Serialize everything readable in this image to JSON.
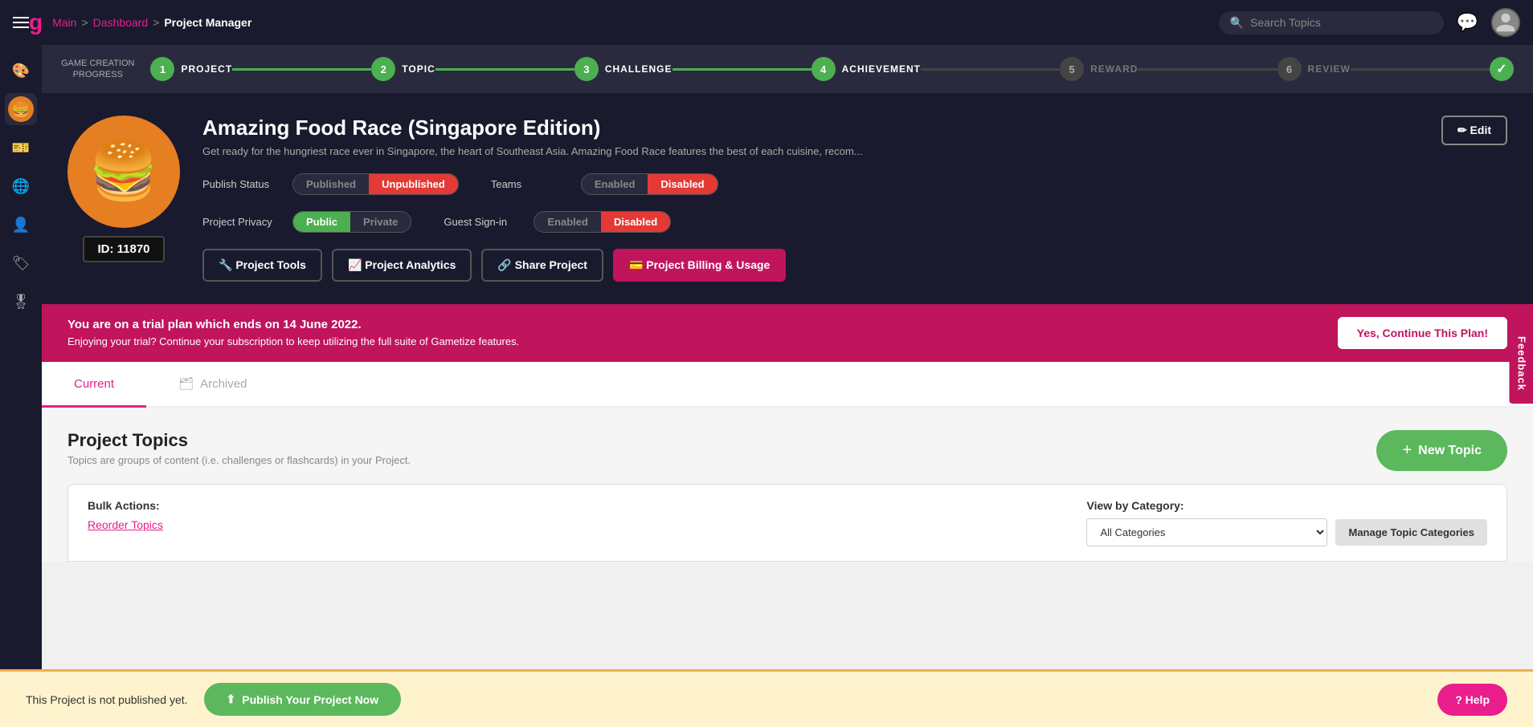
{
  "nav": {
    "brand": "g",
    "breadcrumb": {
      "main": "Main",
      "sep1": ">",
      "dashboard": "Dashboard",
      "sep2": ">",
      "current": "Project Manager"
    },
    "search_placeholder": "Search Topics",
    "feedback": "Feedback"
  },
  "progress": {
    "label_line1": "GAME CREATION",
    "label_line2": "PROGRESS",
    "steps": [
      {
        "num": "1",
        "label": "PROJECT",
        "state": "green"
      },
      {
        "num": "2",
        "label": "TOPIC",
        "state": "green"
      },
      {
        "num": "3",
        "label": "CHALLENGE",
        "state": "green"
      },
      {
        "num": "4",
        "label": "ACHIEVEMENT",
        "state": "green"
      },
      {
        "num": "5",
        "label": "REWARD",
        "state": "grey"
      },
      {
        "num": "6",
        "label": "REVIEW",
        "state": "grey"
      },
      {
        "num": "✓",
        "label": "",
        "state": "check"
      }
    ]
  },
  "project": {
    "title": "Amazing Food Race (Singapore Edition)",
    "description": "Get ready for the hungriest race ever in Singapore, the heart of Southeast Asia. Amazing Food Race features the best of each cuisine, recom...",
    "id": "ID: 11870",
    "edit_label": "✏ Edit",
    "publish_status": {
      "label": "Publish Status",
      "published": "Published",
      "unpublished": "Unpublished",
      "active": "unpublished"
    },
    "project_privacy": {
      "label": "Project Privacy",
      "public": "Public",
      "private": "Private",
      "active": "public"
    },
    "teams": {
      "label": "Teams",
      "enabled": "Enabled",
      "disabled": "Disabled",
      "active": "disabled"
    },
    "guest_signin": {
      "label": "Guest Sign-in",
      "enabled": "Enabled",
      "disabled": "Disabled",
      "active": "disabled"
    },
    "actions": {
      "tools": "🔧 Project Tools",
      "analytics": "📈 Project Analytics",
      "share": "🔗 Share Project",
      "billing": "💳 Project Billing & Usage"
    }
  },
  "trial": {
    "line1": "You are on a trial plan which ends on 14 June 2022.",
    "line2": "Enjoying your trial? Continue your subscription to keep utilizing the full suite of Gametize features.",
    "button": "Yes, Continue This Plan!"
  },
  "tabs": {
    "current": "Current",
    "archived": "Archived"
  },
  "topics": {
    "title": "Project Topics",
    "subtitle": "Topics are groups of content (i.e. challenges or flashcards) in your Project.",
    "new_topic": "New Topic",
    "bulk_label": "Bulk Actions:",
    "reorder": "Reorder Topics",
    "view_category_label": "View by Category:",
    "category_placeholder": "All Categories",
    "manage_btn": "Manage Topic Categories"
  },
  "publish_bar": {
    "text": "This Project is not published yet.",
    "button": "Publish Your Project Now",
    "help": "? Help"
  }
}
